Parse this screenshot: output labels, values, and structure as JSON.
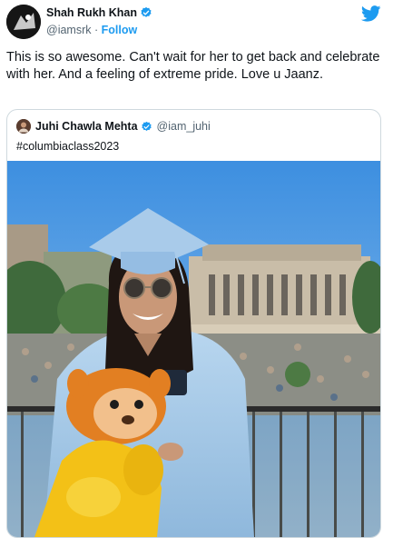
{
  "author": {
    "name": "Shah Rukh Khan",
    "handle": "@iamsrk",
    "separator": "·",
    "follow_label": "Follow"
  },
  "tweet_text": "This is so awesome. Can't wait for her to get back and celebrate with her. And a feeling of extreme pride. Love u Jaanz.",
  "quoted": {
    "name": "Juhi Chawla Mehta",
    "handle": "@iam_juhi",
    "text": "#columbiaclass2023"
  },
  "icons": {
    "verified": "verified-badge-icon",
    "brand": "twitter-bird-icon"
  },
  "colors": {
    "brand": "#1d9bf0",
    "text": "#0f1419",
    "muted": "#536471",
    "border": "#cfd9de"
  }
}
